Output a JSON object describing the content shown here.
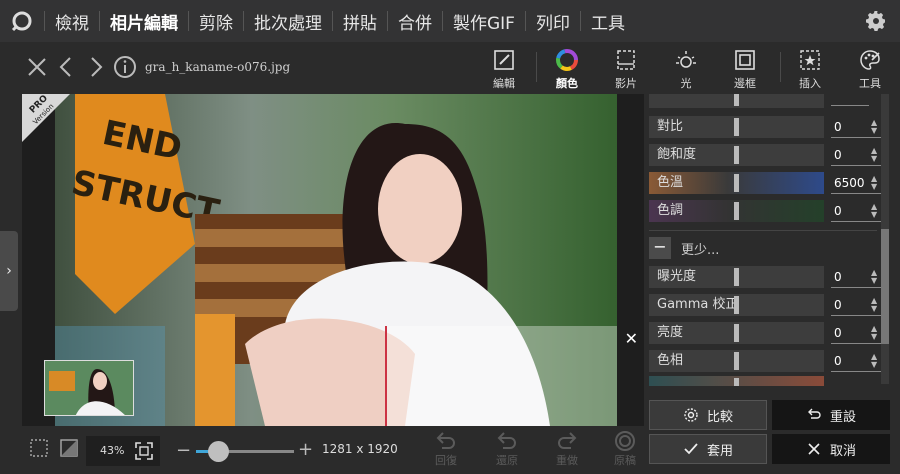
{
  "nav": {
    "items": [
      "檢視",
      "相片編輯",
      "剪除",
      "批次處理",
      "拼貼",
      "合併",
      "製作GIF",
      "列印",
      "工具"
    ],
    "active_index": 1
  },
  "file": {
    "name": "gra_h_kaname-o076.jpg"
  },
  "tools": [
    {
      "label": "編輯",
      "icon": "edit-icon"
    },
    {
      "label": "顏色",
      "icon": "color-wheel-icon",
      "active": true
    },
    {
      "label": "影片",
      "icon": "film-icon"
    },
    {
      "label": "光",
      "icon": "sun-icon"
    },
    {
      "label": "邊框",
      "icon": "frame-icon"
    },
    {
      "label": "插入",
      "icon": "insert-star-icon"
    },
    {
      "label": "工具",
      "icon": "palette-icon"
    }
  ],
  "badge": {
    "pro": "PRO",
    "version": "Version"
  },
  "adjustments": [
    {
      "label": "對比",
      "value": "0"
    },
    {
      "label": "飽和度",
      "value": "0"
    },
    {
      "label": "色溫",
      "value": "6500"
    },
    {
      "label": "色調",
      "value": "0"
    }
  ],
  "more": {
    "label": "更少..."
  },
  "adjustments_more": [
    {
      "label": "曝光度",
      "value": "0"
    },
    {
      "label": "Gamma 校正",
      "value": "0"
    },
    {
      "label": "亮度",
      "value": "0"
    },
    {
      "label": "色相",
      "value": "0"
    }
  ],
  "buttons": {
    "compare": "比較",
    "reset": "重設",
    "apply": "套用",
    "cancel": "取消"
  },
  "bottom": {
    "zoom": "43%",
    "dims": "1281 x 1920",
    "undo_buttons": [
      "回復",
      "還原",
      "重做",
      "原稿"
    ]
  },
  "colors": {
    "accent_blue": "#3fa6d9",
    "temp_warm": "#8a5a36",
    "temp_cool": "#2e4a8a",
    "tint_purple": "#4b3550",
    "tint_green": "#24402a"
  }
}
